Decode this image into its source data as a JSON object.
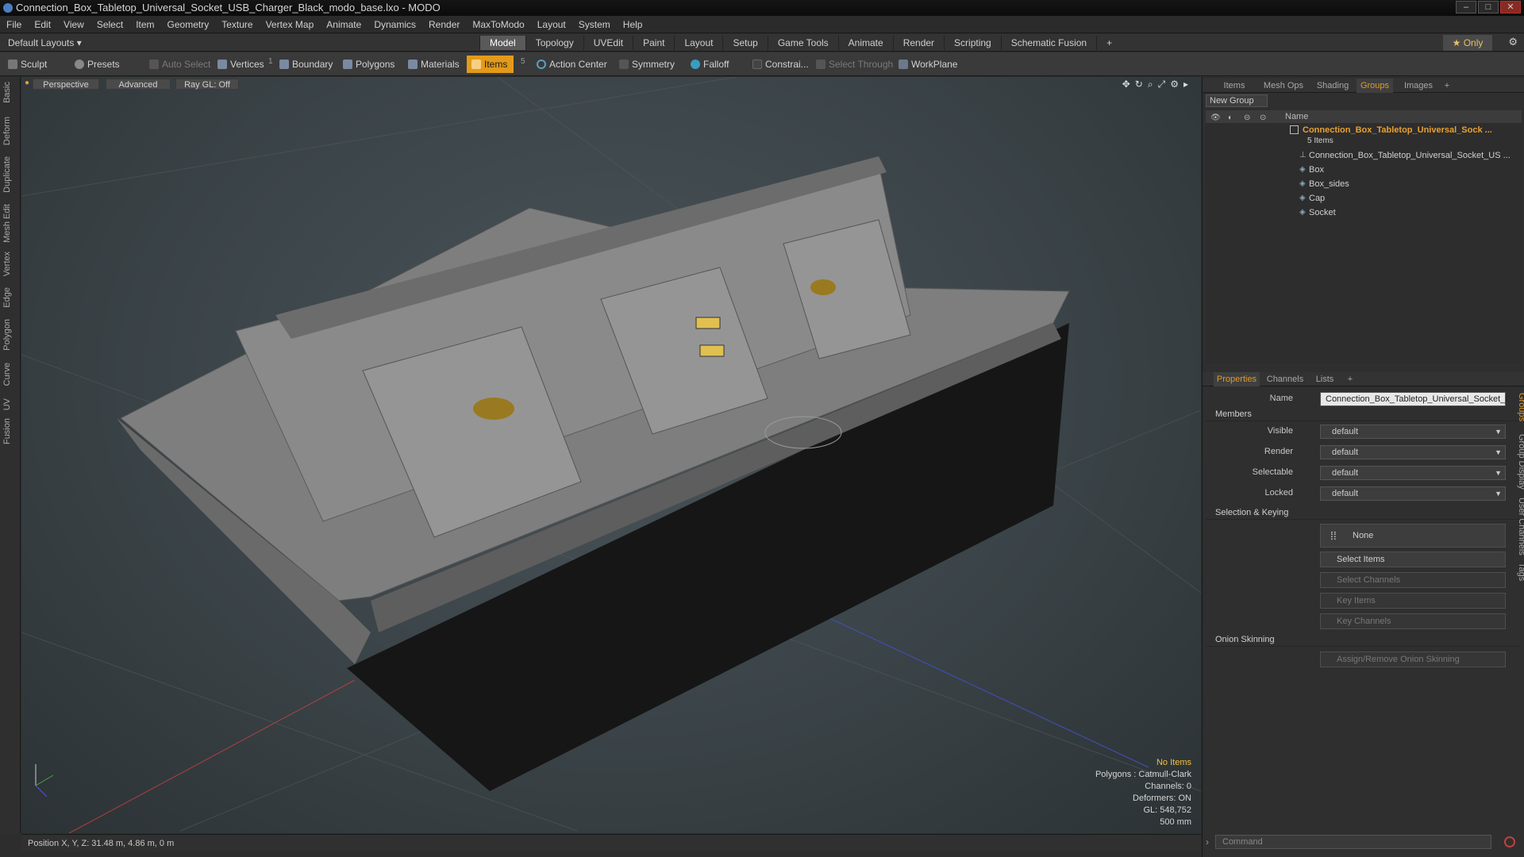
{
  "window": {
    "title": "Connection_Box_Tabletop_Universal_Socket_USB_Charger_Black_modo_base.lxo - MODO",
    "controls": [
      "–",
      "□",
      "✕"
    ]
  },
  "menubar": {
    "items": [
      "File",
      "Edit",
      "View",
      "Select",
      "Item",
      "Geometry",
      "Texture",
      "Vertex Map",
      "Animate",
      "Dynamics",
      "Render",
      "MaxToModo",
      "Layout",
      "System",
      "Help"
    ]
  },
  "layoutbar": {
    "layouts_label": "Default Layouts ▾",
    "tabs": [
      "Model",
      "Topology",
      "UVEdit",
      "Paint",
      "Layout",
      "Setup",
      "Game Tools",
      "Animate",
      "Render",
      "Scripting",
      "Schematic Fusion",
      "+"
    ],
    "active_tab": "Model",
    "only_label": "★ Only"
  },
  "toolbar": {
    "sculpt": "Sculpt",
    "presets": "Presets",
    "auto_select": "Auto Select",
    "vertices": "Vertices",
    "vertices_count": "1",
    "boundary": "Boundary",
    "polygons": "Polygons",
    "materials": "Materials",
    "items": "Items",
    "items_count": "5",
    "action_center": "Action Center",
    "symmetry": "Symmetry",
    "falloff": "Falloff",
    "constraints": "Constrai...",
    "select_through": "Select Through",
    "workplane": "WorkPlane"
  },
  "left_tabs": [
    "Basic",
    "Deform",
    "Duplicate",
    "Mesh Edit",
    "Vertex",
    "Edge",
    "Polygon",
    "Curve",
    "UV",
    "Fusion"
  ],
  "viewport": {
    "view": "Perspective",
    "shading": "Advanced",
    "raygl": "Ray GL: Off",
    "stats": {
      "selection": "No Items",
      "polygons": "Polygons : Catmull-Clark",
      "channels": "Channels: 0",
      "deformers": "Deformers: ON",
      "gl": "GL: 548,752",
      "scale": "500 mm"
    }
  },
  "statusbar": {
    "position": "Position X, Y, Z:  31.48 m, 4.86 m, 0 m"
  },
  "groups_panel": {
    "tabs": [
      "Items",
      "Mesh Ops",
      "Shading",
      "Groups",
      "Images",
      "+"
    ],
    "active_tab": "Groups",
    "new_group": "New Group",
    "column_name": "Name",
    "group_name": "Connection_Box_Tabletop_Universal_Sock ...",
    "group_count": "5 Items",
    "members": [
      "Connection_Box_Tabletop_Universal_Socket_US ...",
      "Box",
      "Box_sides",
      "Cap",
      "Socket"
    ]
  },
  "properties_panel": {
    "tabs": [
      "Properties",
      "Channels",
      "Lists",
      "+"
    ],
    "active_tab": "Properties",
    "name_label": "Name",
    "name_value": "Connection_Box_Tabletop_Universal_Socket_I",
    "members_section": "Members",
    "fields": [
      {
        "label": "Visible",
        "value": "default"
      },
      {
        "label": "Render",
        "value": "default"
      },
      {
        "label": "Selectable",
        "value": "default"
      },
      {
        "label": "Locked",
        "value": "default"
      }
    ],
    "selection_section": "Selection & Keying",
    "none_label": "None",
    "buttons": [
      "Select Items",
      "Select Channels",
      "Key Items",
      "Key Channels"
    ],
    "onion_section": "Onion Skinning",
    "onion_button": "Assign/Remove Onion Skinning",
    "side_tabs": [
      "Groups",
      "Group Display",
      "User Channels",
      "Tags"
    ],
    "command_placeholder": "Command"
  },
  "colors": {
    "accent": "#e39a1a",
    "active_tab_text": "#e09a2a",
    "group_name": "#e8a030"
  }
}
